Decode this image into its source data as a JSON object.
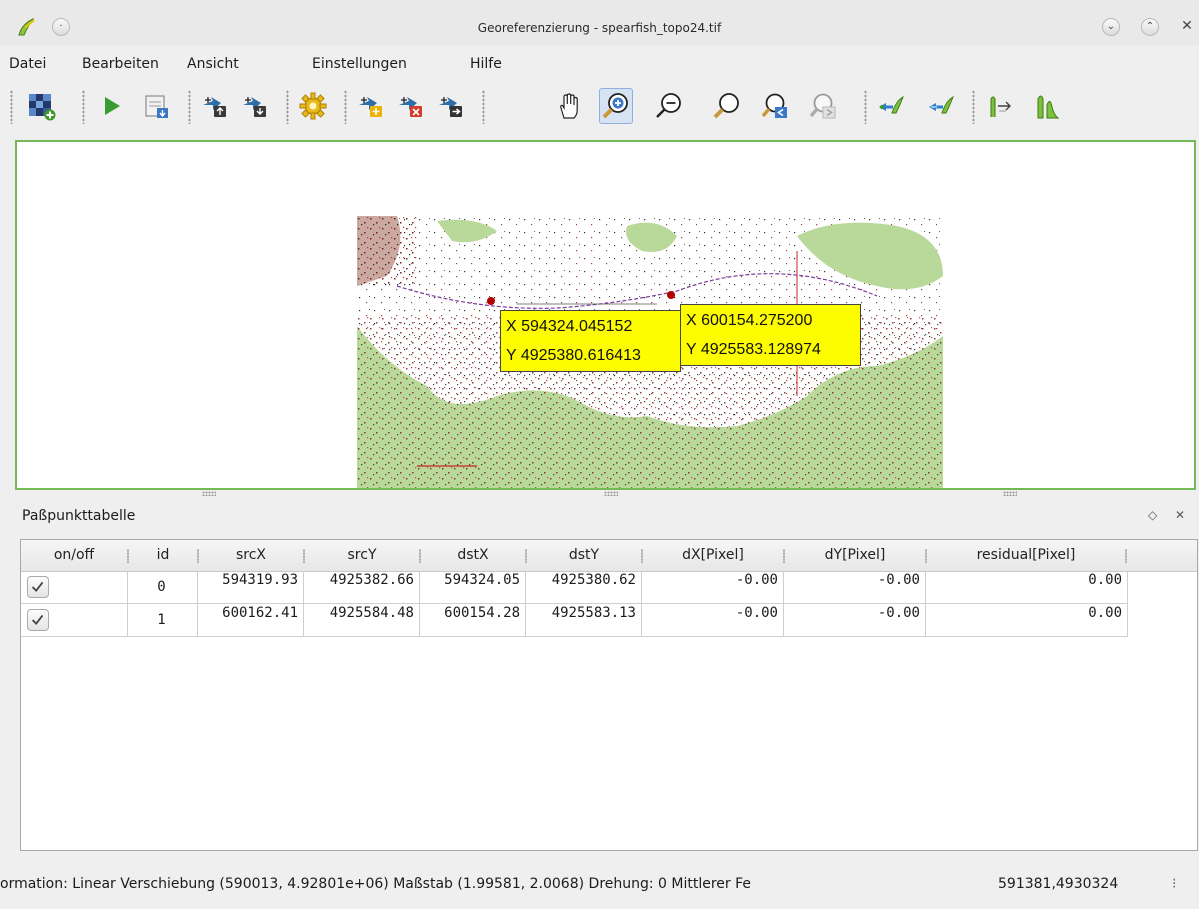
{
  "window": {
    "title": "Georeferenzierung - spearfish_topo24.tif"
  },
  "menu": [
    "Datei",
    "Bearbeiten",
    "Ansicht",
    "Einstellungen",
    "Hilfe"
  ],
  "toolbar": {
    "icons": [
      "open-raster-icon",
      "start-georeferencing-icon",
      "generate-gdal-script-icon",
      "load-gcp-points-icon",
      "save-gcp-points-icon",
      "transformation-settings-icon",
      "add-point-icon",
      "delete-point-icon",
      "move-point-icon",
      "pan-icon",
      "zoom-in-icon",
      "zoom-out-icon",
      "zoom-to-layer-icon",
      "zoom-last-icon",
      "zoom-next-icon",
      "link-georeferencer-to-qgis-icon",
      "link-qgis-to-georeferencer-icon",
      "full-histogram-stretch-icon",
      "local-histogram-stretch-icon"
    ],
    "active": "zoom-in-icon"
  },
  "canvas": {
    "points": [
      {
        "x_label": "X 594324.045152",
        "y_label": "Y 4925380.616413"
      },
      {
        "x_label": "X 600154.275200",
        "y_label": "Y 4925583.128974"
      }
    ]
  },
  "gcp_panel": {
    "title": "Paßpunkttabelle",
    "columns": [
      "on/off",
      "id",
      "srcX",
      "srcY",
      "dstX",
      "dstY",
      "dX[Pixel]",
      "dY[Pixel]",
      "residual[Pixel]"
    ],
    "rows": [
      {
        "on": true,
        "id": "0",
        "srcX": "594319.93",
        "srcY": "4925382.66",
        "dstX": "594324.05",
        "dstY": "4925380.62",
        "dX": "-0.00",
        "dY": "-0.00",
        "residual": "0.00"
      },
      {
        "on": true,
        "id": "1",
        "srcX": "600162.41",
        "srcY": "4925584.48",
        "dstX": "600154.28",
        "dstY": "4925583.13",
        "dX": "-0.00",
        "dY": "-0.00",
        "residual": "0.00"
      }
    ]
  },
  "statusbar": {
    "message": "ormation: Linear Verschiebung (590013, 4.92801e+06) Maßstab (1.99581, 2.0068) Drehung: 0 Mittlerer Fe",
    "coords": "591381,4930324"
  }
}
